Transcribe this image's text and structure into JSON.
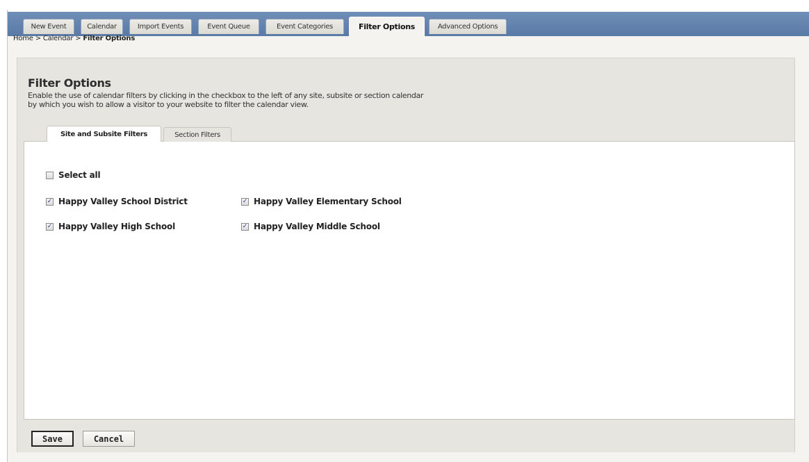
{
  "tabs": [
    {
      "label": "New Event"
    },
    {
      "label": "Calendar"
    },
    {
      "label": "Import Events"
    },
    {
      "label": "Event Queue"
    },
    {
      "label": "Event Categories"
    },
    {
      "label": "Filter Options",
      "active": true
    },
    {
      "label": "Advanced Options"
    }
  ],
  "breadcrumb": {
    "items": [
      "Home",
      "Calendar",
      "Filter Options"
    ],
    "separator": ">"
  },
  "page": {
    "title": "Filter Options",
    "description_lines": [
      "Enable the use of calendar filters by clicking in the checkbox to the left of any site, subsite or section calendar",
      "by which you wish to allow a visitor to your website to filter the calendar view."
    ]
  },
  "sub_tabs": [
    {
      "label": "Site and Subsite Filters",
      "active": true
    },
    {
      "label": "Section Filters",
      "active": false
    }
  ],
  "filters": {
    "select_all": {
      "label": "Select all",
      "checked": false
    },
    "options": [
      {
        "label": "Happy Valley School District",
        "checked": true
      },
      {
        "label": "Happy Valley Elementary School",
        "checked": true
      },
      {
        "label": "Happy Valley High School",
        "checked": true
      },
      {
        "label": "Happy Valley Middle School",
        "checked": true
      }
    ]
  },
  "buttons": {
    "save": "Save",
    "cancel": "Cancel"
  },
  "icons": {
    "checkbox_checked": "check-icon"
  },
  "colors": {
    "tab_bar": "#5a7aa6",
    "panel_background": "#e7e5df",
    "content_background": "#ffffff"
  }
}
